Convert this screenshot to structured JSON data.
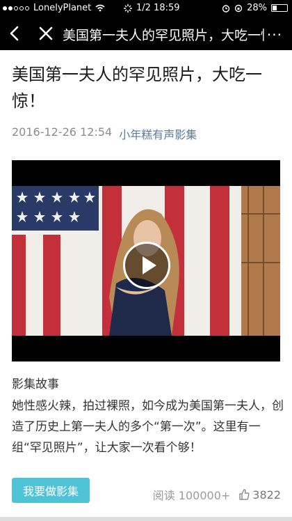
{
  "status": {
    "carrier": "LonelyPlanet",
    "time": "1/2 18:59",
    "battery": "28%",
    "battery_level": 0.28
  },
  "nav": {
    "title": "美国第一夫人的罕见照片，大吃一惊！",
    "more": "..."
  },
  "article": {
    "title": "美国第一夫人的罕见照片，大吃一惊！",
    "date": "2016-12-26 12:54",
    "author": "小年糕有声影集"
  },
  "story": {
    "label": "影集故事",
    "text": "她性感火辣，拍过裸照，如今成为美国第一夫人，创造了历史上第一夫人的多个“第一次”。这里有一组“罕见照片”，让大家一次看个够！"
  },
  "actions": {
    "make_album": "我要做影集",
    "reads": "阅读 100000+",
    "likes": "3822"
  },
  "colors": {
    "accent": "#4ec3d6",
    "author_link": "#5a7a9a"
  }
}
